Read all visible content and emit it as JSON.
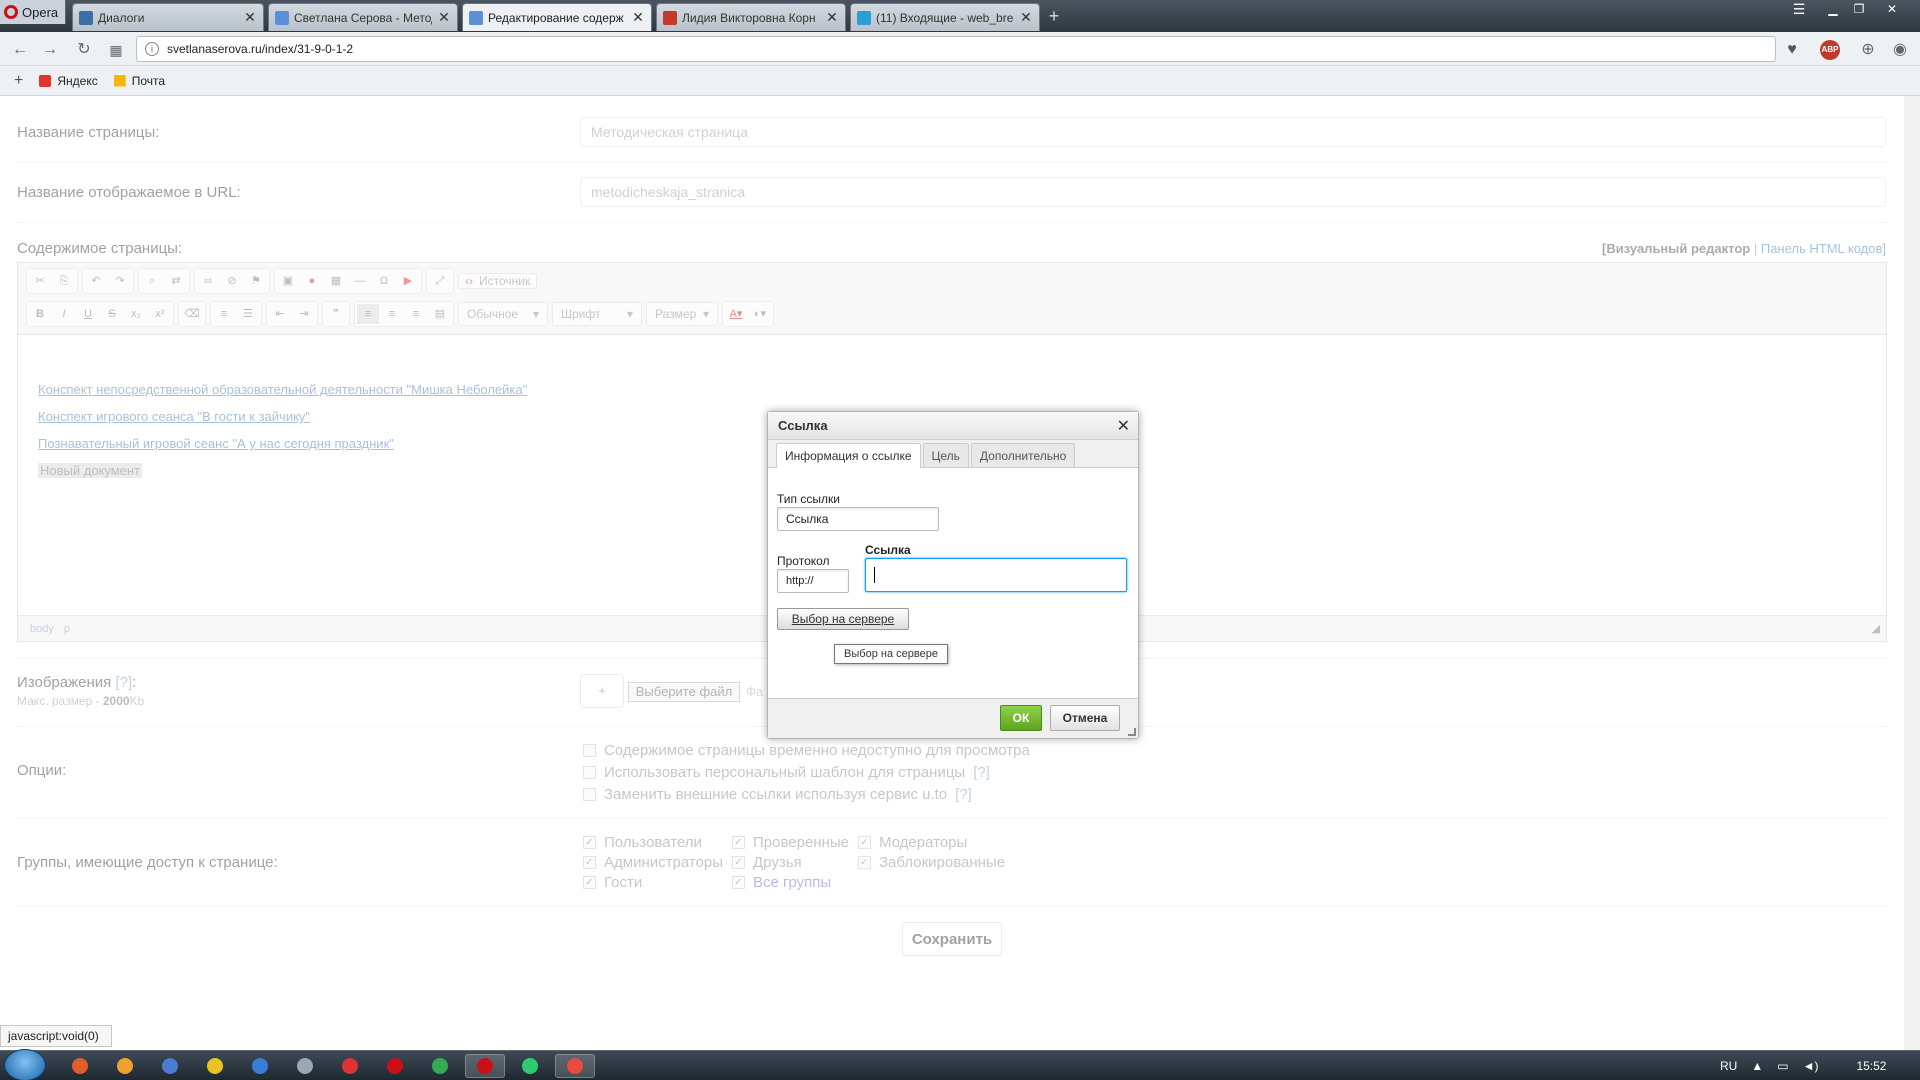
{
  "browser": {
    "menu_label": "Opera",
    "tabs": [
      {
        "title": "Диалоги",
        "color": "#3a6ea5"
      },
      {
        "title": "Светлана Серова - Метод",
        "color": "#5b8fd8"
      },
      {
        "title": "Редактирование содерж",
        "color": "#5b8fd8",
        "active": true
      },
      {
        "title": "Лидия Викторовна Корн",
        "color": "#c0392b"
      },
      {
        "title": "(11) Входящие - web_bre",
        "color": "#2a9fd6"
      }
    ],
    "url": "svetlanaserova.ru/index/31-9-0-1-2",
    "bookmarks": [
      {
        "label": "Яндекс",
        "icon": "yandex-icon",
        "color": "#e3342f"
      },
      {
        "label": "Почта",
        "icon": "mail-icon",
        "color": "#f6b60a"
      }
    ],
    "status_text": "javascript:void(0)"
  },
  "form": {
    "page_name_label": "Название страницы:",
    "page_name_value": "Методическая страница",
    "url_name_label": "Название отображаемое в URL:",
    "url_name_value": "metodicheskaja_stranica",
    "content_label": "Содержимое страницы:",
    "editor_mode_visual": "[Визуальный редактор",
    "editor_mode_sep": " | ",
    "editor_mode_html": "Панель HTML кодов]",
    "toolbar": {
      "source_label": "Источник",
      "format_combo": "Обычное",
      "font_combo": "Шрифт",
      "size_combo": "Размер"
    },
    "content_links": [
      "Конспект непосредственной образовательной деятельности \"Мишка Неболейка\"",
      "Конспект игрового сеанса \"В гости к зайчику\"",
      "Познавательный игровой сеанс \"А у нас сегодня праздник\""
    ],
    "new_document": "Новый документ",
    "path_body": "body",
    "path_p": "p",
    "images_label": "Изображения",
    "images_help": "[?]",
    "images_colon": ":",
    "images_max_prefix": "Макс. размер - ",
    "images_max_value": "2000",
    "images_max_unit": "Kb",
    "add_button": "+",
    "choose_file_button": "Выберите файл",
    "file_hint": "Фа",
    "options_label": "Опции:",
    "options": [
      {
        "label": "Содержимое страницы временно недоступно для просмотра",
        "help": ""
      },
      {
        "label": "Использовать персональный шаблон для страницы",
        "help": "[?]"
      },
      {
        "label": "Заменить внешние ссылки используя сервис u.to",
        "help": "[?]"
      }
    ],
    "groups_label": "Группы, имеющие доступ к странице:",
    "groups": [
      {
        "label": "Пользователи",
        "checked": true
      },
      {
        "label": "Администраторы",
        "checked": true
      },
      {
        "label": "Гости",
        "checked": true
      },
      {
        "label": "Проверенные",
        "checked": true
      },
      {
        "label": "Друзья",
        "checked": true
      },
      {
        "label": "Все группы",
        "checked": true
      },
      {
        "label": "Модераторы",
        "checked": true
      },
      {
        "label": "Заблокированные",
        "checked": true
      }
    ],
    "save_button": "Сохранить"
  },
  "dialog": {
    "title": "Ссылка",
    "tabs": [
      "Информация о ссылке",
      "Цель",
      "Дополнительно"
    ],
    "link_type_label": "Тип ссылки",
    "link_type_value": "Ссылка",
    "protocol_label": "Протокол",
    "protocol_value": "http://",
    "url_label": "Ссылка",
    "url_value": "",
    "server_button": "Выбор на сервере",
    "tooltip": "Выбор на сервере",
    "ok_button": "ОК",
    "cancel_button": "Отмена"
  },
  "taskbar": {
    "apps": [
      {
        "icon": "app-icon-1",
        "color": "#e25d2b"
      },
      {
        "icon": "app-icon-2",
        "color": "#f0a030"
      },
      {
        "icon": "app-icon-3",
        "color": "#4b7bd1"
      },
      {
        "icon": "app-icon-4",
        "color": "#e8c422"
      },
      {
        "icon": "app-icon-5",
        "color": "#3a7dd8"
      },
      {
        "icon": "app-icon-6",
        "color": "#9aa7b5"
      },
      {
        "icon": "app-icon-7",
        "color": "#d33"
      },
      {
        "icon": "app-icon-8",
        "color": "#cc0f16"
      },
      {
        "icon": "app-icon-9",
        "color": "#34a853"
      },
      {
        "icon": "opera-icon",
        "color": "#cc0f16",
        "active": true
      },
      {
        "icon": "app-icon-11",
        "color": "#2ecc71"
      },
      {
        "icon": "app-icon-12",
        "color": "#e74c3c",
        "active": true
      }
    ],
    "lang": "RU",
    "clock": "15:52"
  }
}
